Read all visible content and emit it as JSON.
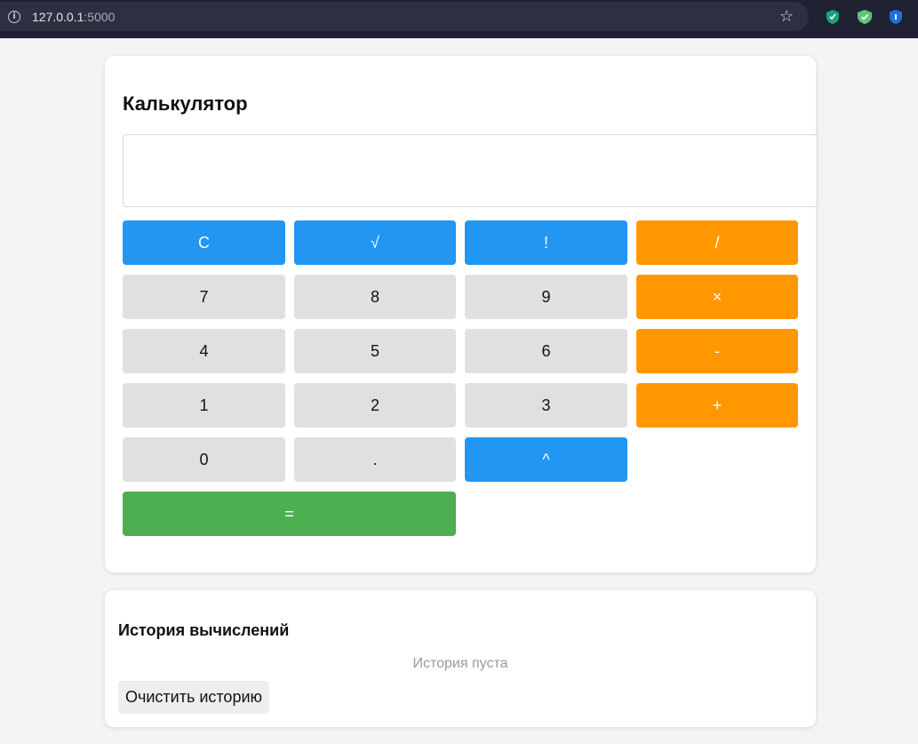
{
  "browser": {
    "url_host": "127.0.0.1",
    "url_port": ":5000",
    "icons": [
      "info-icon",
      "bookmark-star-icon",
      "shield-extension-icon",
      "shield-check-extension-icon",
      "bitwarden-extension-icon"
    ]
  },
  "calculator": {
    "title": "Калькулятор",
    "display_value": "",
    "buttons": {
      "clear": "C",
      "sqrt": "√",
      "factorial": "!",
      "divide": "/",
      "seven": "7",
      "eight": "8",
      "nine": "9",
      "multiply": "×",
      "four": "4",
      "five": "5",
      "six": "6",
      "minus": "-",
      "one": "1",
      "two": "2",
      "three": "3",
      "plus": "+",
      "zero": "0",
      "dot": ".",
      "power": "^",
      "equals": "="
    }
  },
  "history": {
    "title": "История вычислений",
    "empty_text": "История пуста",
    "clear_label": "Очистить историю"
  },
  "colors": {
    "function_blue": "#2196f3",
    "operator_orange": "#ff9800",
    "equals_green": "#4caf50",
    "digit_gray": "#e0e0e0"
  }
}
